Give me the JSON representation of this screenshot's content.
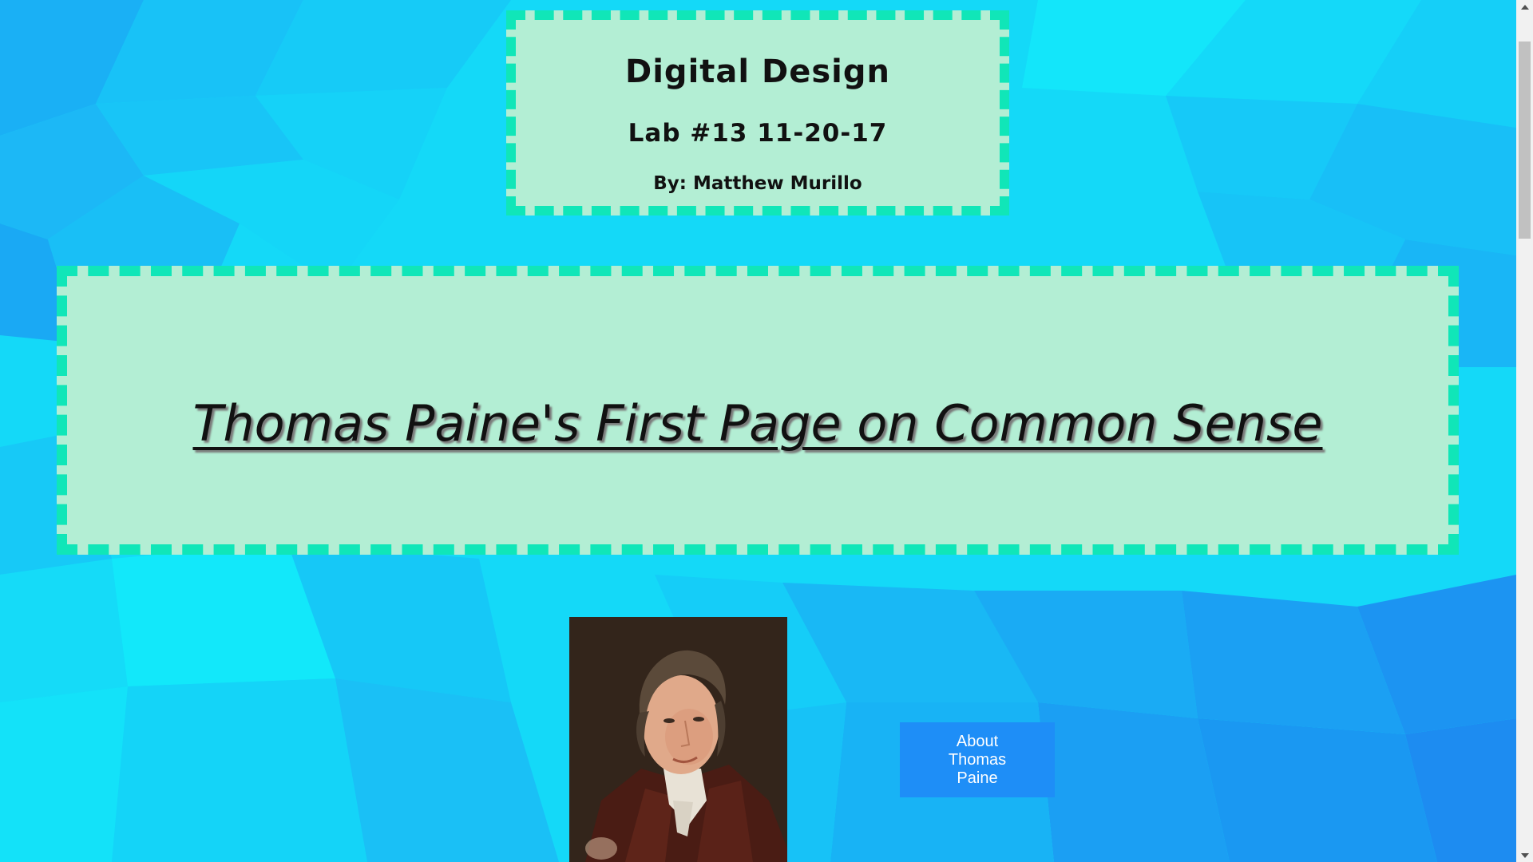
{
  "header": {
    "title": "Digital Design",
    "lab": "Lab #13 11-20-17",
    "author": "By: Matthew Murillo"
  },
  "main": {
    "title": "Thomas Paine's First Page on Common Sense"
  },
  "about_button": {
    "label": "About Thomas Paine"
  },
  "colors": {
    "background": "#12d6f7",
    "panel": "#b3eed4",
    "panel_border": "#10e6b8",
    "button": "#1e8ef7"
  },
  "icons": {
    "scroll_up": "chevron-up-icon",
    "scroll_down": "chevron-down-icon"
  }
}
